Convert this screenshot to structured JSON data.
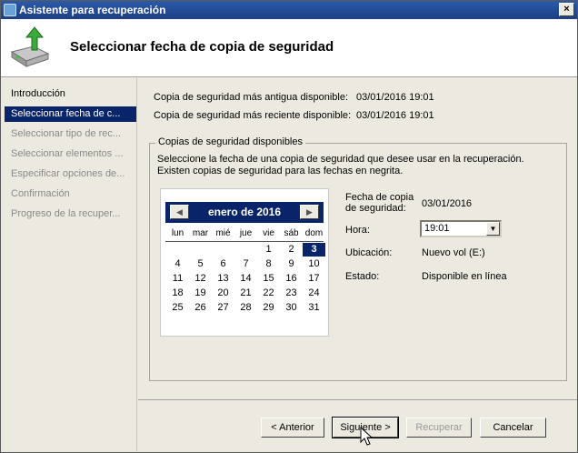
{
  "window": {
    "title": "Asistente para recuperación",
    "close_glyph": "×"
  },
  "header": {
    "title": "Seleccionar fecha de copia de seguridad",
    "icon": "backup-restore-icon"
  },
  "sidebar": {
    "steps": [
      {
        "label": "Introducción",
        "state": "done"
      },
      {
        "label": "Seleccionar fecha de c...",
        "state": "active"
      },
      {
        "label": "Seleccionar tipo de rec...",
        "state": "pending"
      },
      {
        "label": "Seleccionar elementos ...",
        "state": "pending"
      },
      {
        "label": "Especificar opciones de...",
        "state": "pending"
      },
      {
        "label": "Confirmación",
        "state": "pending"
      },
      {
        "label": "Progreso de la recuper...",
        "state": "pending"
      }
    ]
  },
  "info": {
    "oldest_label": "Copia de seguridad más antigua disponible:",
    "oldest_value": "03/01/2016 19:01",
    "newest_label": "Copia de seguridad más reciente disponible:",
    "newest_value": "03/01/2016 19:01"
  },
  "group": {
    "title": "Copias de seguridad disponibles",
    "description": "Seleccione la fecha de una copia de seguridad que desee usar en la recuperación. Existen copias de seguridad para las fechas en negrita."
  },
  "calendar": {
    "month": "enero de 2016",
    "prev_glyph": "◀",
    "next_glyph": "▶",
    "weekdays": [
      "lun",
      "mar",
      "mié",
      "jue",
      "vie",
      "sáb",
      "dom"
    ],
    "selected_day": "3",
    "weeks": [
      [
        "",
        "",
        "",
        "",
        "1",
        "2",
        "3"
      ],
      [
        "4",
        "5",
        "6",
        "7",
        "8",
        "9",
        "10"
      ],
      [
        "11",
        "12",
        "13",
        "14",
        "15",
        "16",
        "17"
      ],
      [
        "18",
        "19",
        "20",
        "21",
        "22",
        "23",
        "24"
      ],
      [
        "25",
        "26",
        "27",
        "28",
        "29",
        "30",
        "31"
      ]
    ]
  },
  "details": {
    "date_label_line1": "Fecha de copia",
    "date_label_line2": "de seguridad:",
    "date_value": "03/01/2016",
    "time_label": "Hora:",
    "time_value": "19:01",
    "location_label": "Ubicación:",
    "location_value": "Nuevo vol (E:)",
    "status_label": "Estado:",
    "status_value": "Disponible en línea"
  },
  "buttons": {
    "back": "< Anterior",
    "next": "Siguiente >",
    "recover": "Recuperar",
    "cancel": "Cancelar"
  }
}
